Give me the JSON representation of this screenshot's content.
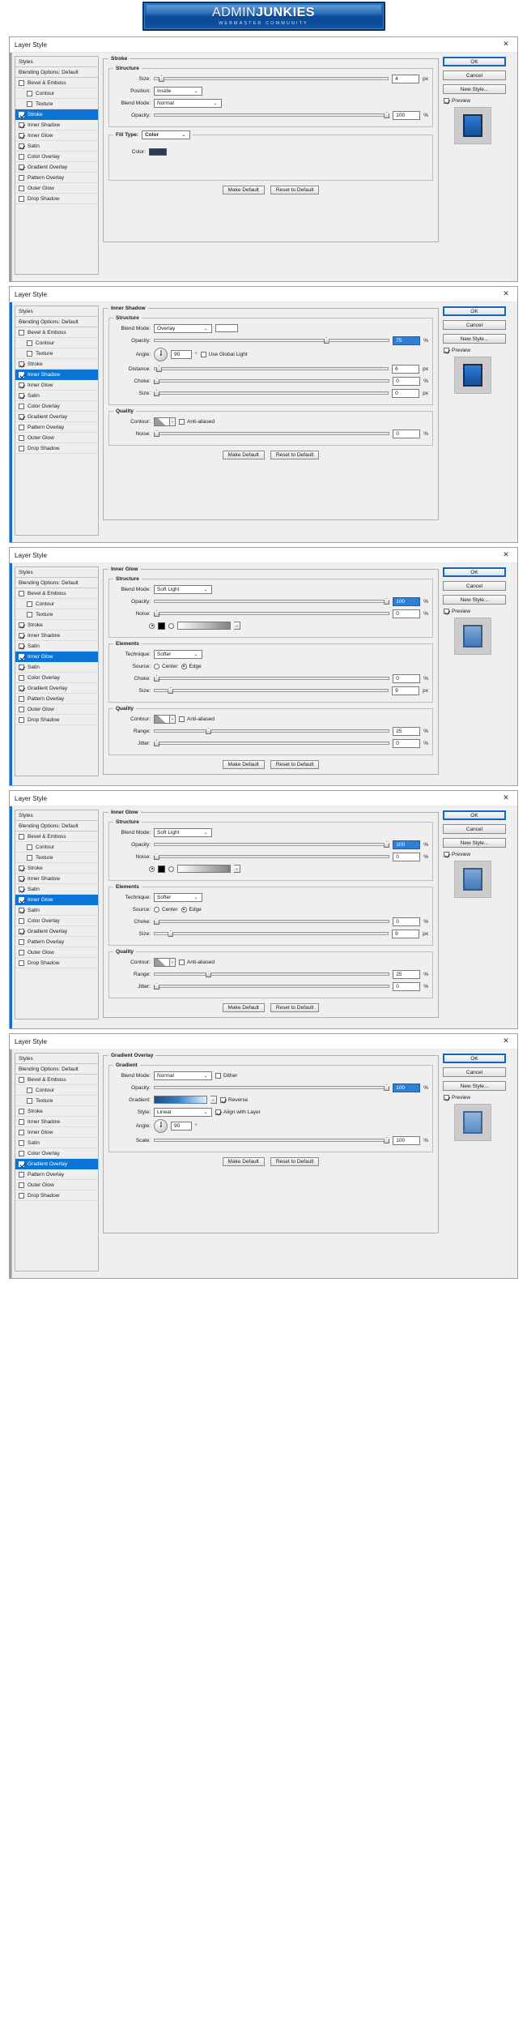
{
  "banner": {
    "title_thin": "ADMIN",
    "title_bold": "JUNKIES",
    "subtitle": "WEBMASTER COMMUNITY"
  },
  "common": {
    "dialog_title": "Layer Style",
    "close_icon": "✕",
    "styles_header": "Styles",
    "blending_options": "Blending Options: Default",
    "make_default": "Make Default",
    "reset_to_default": "Reset to Default",
    "ok": "OK",
    "cancel": "Cancel",
    "new_style": "New Style...",
    "preview": "Preview",
    "chevron": "⌄",
    "px": "px",
    "percent": "%",
    "degree": "°"
  },
  "style_labels": {
    "bevel": "Bevel & Emboss",
    "contour": "Contour",
    "texture": "Texture",
    "stroke": "Stroke",
    "inner_shadow": "Inner Shadow",
    "inner_glow": "Inner Glow",
    "satin": "Satin",
    "color_overlay": "Color Overlay",
    "gradient_overlay": "Gradient Overlay",
    "pattern_overlay": "Pattern Overlay",
    "outer_glow": "Outer Glow",
    "drop_shadow": "Drop Shadow"
  },
  "dialogs": [
    {
      "id": "stroke",
      "selected": "stroke",
      "checks": {
        "bevel": false,
        "contour": false,
        "texture": false,
        "stroke": true,
        "inner_shadow": true,
        "inner_glow": true,
        "satin": true,
        "color_overlay": false,
        "gradient_overlay": true,
        "pattern_overlay": false,
        "outer_glow": false,
        "drop_shadow": false
      },
      "panel_title": "Stroke",
      "structure_title": "Structure",
      "fields": {
        "size_label": "Size:",
        "size_value": "4",
        "size_unit": "px",
        "position_label": "Position:",
        "position_value": "Inside",
        "blend_mode_label": "Blend Mode:",
        "blend_mode_value": "Normal",
        "opacity_label": "Opacity:",
        "opacity_value": "100",
        "opacity_unit": "%",
        "fill_type_label": "Fill Type:",
        "fill_type_value": "Color",
        "color_label": "Color:",
        "color_swatch": "#2b3b55"
      }
    },
    {
      "id": "inner-shadow",
      "selected": "inner_shadow",
      "checks": {
        "bevel": false,
        "contour": false,
        "texture": false,
        "stroke": true,
        "inner_shadow": true,
        "inner_glow": true,
        "satin": true,
        "color_overlay": false,
        "gradient_overlay": true,
        "pattern_overlay": false,
        "outer_glow": false,
        "drop_shadow": false
      },
      "panel_title": "Inner Shadow",
      "structure_title": "Structure",
      "quality_title": "Quality",
      "fields": {
        "blend_mode_label": "Blend Mode:",
        "blend_mode_value": "Overlay",
        "opacity_label": "Opacity:",
        "opacity_value": "75",
        "opacity_unit": "%",
        "angle_label": "Angle:",
        "angle_value": "90",
        "angle_unit": "°",
        "use_global_light": "Use Global Light",
        "use_global_light_checked": false,
        "distance_label": "Distance:",
        "distance_value": "6",
        "distance_unit": "px",
        "choke_label": "Choke:",
        "choke_value": "0",
        "choke_unit": "%",
        "size_label": "Size:",
        "size_value": "0",
        "size_unit": "px",
        "contour_label": "Contour:",
        "anti_aliased": "Anti-aliased",
        "anti_aliased_checked": false,
        "noise_label": "Noise:",
        "noise_value": "0",
        "noise_unit": "%"
      }
    },
    {
      "id": "inner-glow-1",
      "selected": "inner_glow",
      "checks": {
        "bevel": false,
        "contour": false,
        "texture": false,
        "stroke": true,
        "inner_shadow": true,
        "inner_glow": true,
        "satin": true,
        "color_overlay": false,
        "gradient_overlay": true,
        "pattern_overlay": false,
        "outer_glow": false,
        "drop_shadow": false
      },
      "panel_title": "Inner Glow",
      "structure_title": "Structure",
      "elements_title": "Elements",
      "quality_title": "Quality",
      "fields": {
        "blend_mode_label": "Blend Mode:",
        "blend_mode_value": "Soft Light",
        "opacity_label": "Opacity:",
        "opacity_value": "100",
        "opacity_unit": "%",
        "noise_label": "Noise:",
        "noise_value": "0",
        "noise_unit": "%",
        "technique_label": "Technique:",
        "technique_value": "Softer",
        "source_label": "Source:",
        "source_center": "Center",
        "source_edge": "Edge",
        "source_selected": "Edge",
        "choke_label": "Choke:",
        "choke_value": "0",
        "choke_unit": "%",
        "size_label": "Size:",
        "size_value": "9",
        "size_unit": "px",
        "contour_label": "Contour:",
        "anti_aliased": "Anti-aliased",
        "anti_aliased_checked": false,
        "range_label": "Range:",
        "range_value": "25",
        "range_unit": "%",
        "jitter_label": "Jitter:",
        "jitter_value": "0",
        "jitter_unit": "%"
      }
    },
    {
      "id": "inner-glow-2",
      "selected": "inner_glow",
      "checks": {
        "bevel": false,
        "contour": false,
        "texture": false,
        "stroke": true,
        "inner_shadow": true,
        "inner_glow": true,
        "satin": true,
        "color_overlay": false,
        "gradient_overlay": true,
        "pattern_overlay": false,
        "outer_glow": false,
        "drop_shadow": false
      },
      "panel_title": "Inner Glow",
      "structure_title": "Structure",
      "elements_title": "Elements",
      "quality_title": "Quality",
      "fields": {
        "blend_mode_label": "Blend Mode:",
        "blend_mode_value": "Soft Light",
        "opacity_label": "Opacity:",
        "opacity_value": "100",
        "opacity_unit": "%",
        "noise_label": "Noise:",
        "noise_value": "0",
        "noise_unit": "%",
        "technique_label": "Technique:",
        "technique_value": "Softer",
        "source_label": "Source:",
        "source_center": "Center",
        "source_edge": "Edge",
        "source_selected": "Edge",
        "choke_label": "Choke:",
        "choke_value": "0",
        "choke_unit": "%",
        "size_label": "Size:",
        "size_value": "9",
        "size_unit": "px",
        "contour_label": "Contour:",
        "anti_aliased": "Anti-aliased",
        "anti_aliased_checked": false,
        "range_label": "Range:",
        "range_value": "25",
        "range_unit": "%",
        "jitter_label": "Jitter:",
        "jitter_value": "0",
        "jitter_unit": "%"
      }
    },
    {
      "id": "gradient-overlay",
      "selected": "gradient_overlay",
      "checks": {
        "bevel": false,
        "contour": false,
        "texture": false,
        "stroke": false,
        "inner_shadow": false,
        "inner_glow": false,
        "satin": false,
        "color_overlay": false,
        "gradient_overlay": true,
        "pattern_overlay": false,
        "outer_glow": false,
        "drop_shadow": false
      },
      "panel_title": "Gradient Overlay",
      "structure_title": "Gradient",
      "fields": {
        "blend_mode_label": "Blend Mode:",
        "blend_mode_value": "Normal",
        "dither_label": "Dither",
        "dither_checked": false,
        "opacity_label": "Opacity:",
        "opacity_value": "100",
        "opacity_unit": "%",
        "gradient_label": "Gradient:",
        "reverse_label": "Reverse",
        "reverse_checked": true,
        "style_label": "Style:",
        "style_value": "Linear",
        "align_label": "Align with Layer",
        "align_checked": true,
        "angle_label": "Angle:",
        "angle_value": "90",
        "angle_unit": "°",
        "scale_label": "Scale:",
        "scale_value": "100",
        "scale_unit": "%"
      }
    }
  ]
}
